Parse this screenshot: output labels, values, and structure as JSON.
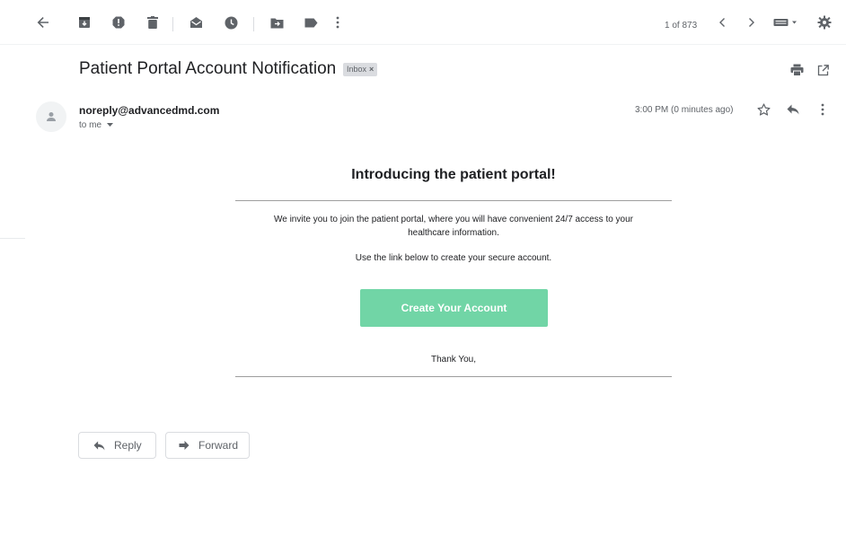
{
  "toolbar": {
    "icons": [
      "back-arrow-icon",
      "archive-icon",
      "report-spam-icon",
      "delete-icon",
      "mark-unread-icon",
      "snooze-icon",
      "move-to-icon",
      "label-icon",
      "more-vert-icon",
      "prev-icon",
      "next-icon",
      "input-tools-icon",
      "settings-icon"
    ],
    "counter": "1 of 873"
  },
  "email": {
    "subject": "Patient Portal Account Notification",
    "label": "Inbox",
    "sender": "noreply@advancedmd.com",
    "to": "to me",
    "time": "3:00 PM (0 minutes ago)"
  },
  "body": {
    "headline": "Introducing the patient portal!",
    "invite_line1": "We invite you to join the patient portal, where you will have convenient 24/7 access to your",
    "invite_line2": "healthcare information.",
    "link_text": "Use the link below to create your secure account.",
    "cta_label": "Create Your Account",
    "closing": "Thank You,"
  },
  "actions": {
    "reply": "Reply",
    "forward": "Forward"
  },
  "colors": {
    "cta": "#71d5a6",
    "icon": "#5f6368"
  }
}
